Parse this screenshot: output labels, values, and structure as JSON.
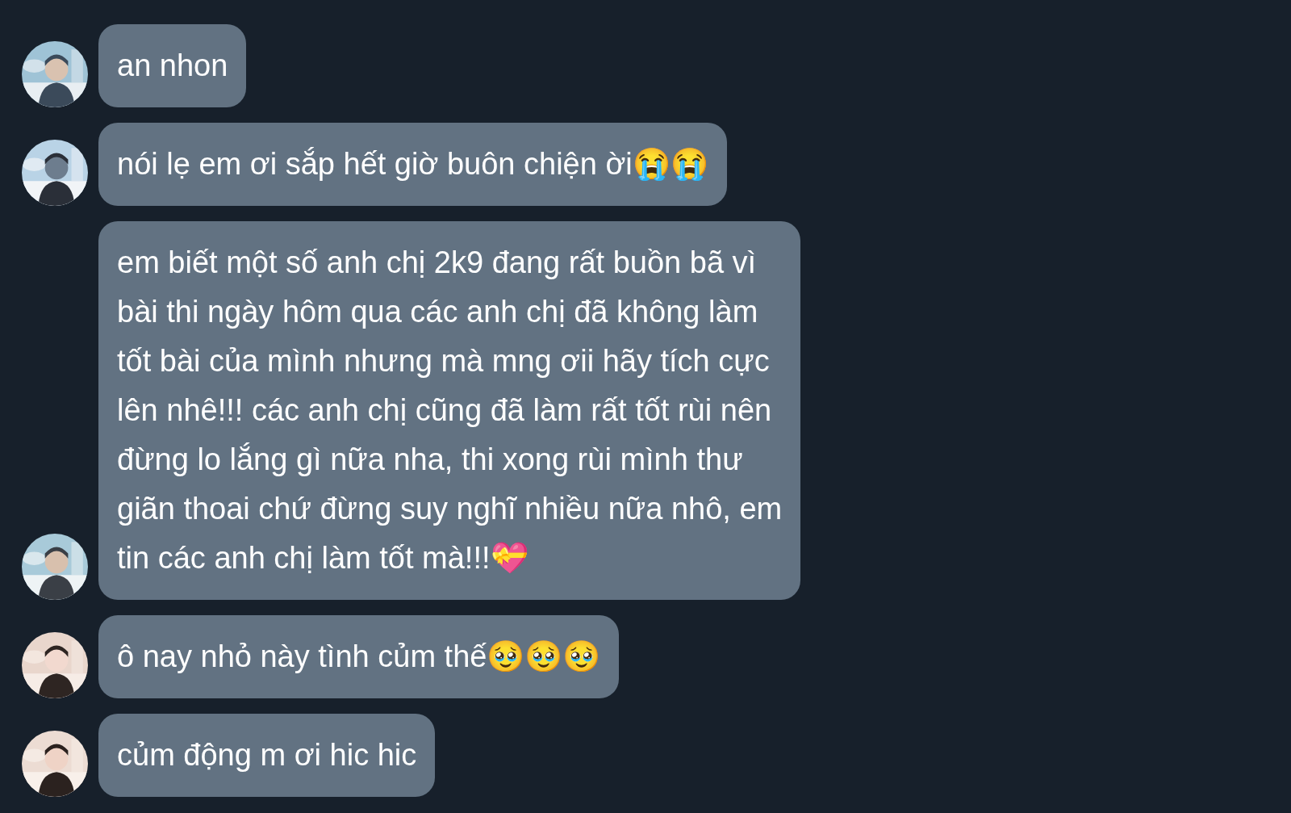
{
  "messages": [
    {
      "text": "an nhon"
    },
    {
      "text": "nói lẹ em ơi sắp hết giờ buôn chiện ời😭😭"
    },
    {
      "text": "em biết một số anh chị 2k9 đang rất buồn bã vì\nbài thi ngày hôm qua các anh chị đã không làm\ntốt bài của mình nhưng mà mng ơii hãy tích cực\nlên nhê!!! các anh chị cũng đã làm rất tốt rùi nên\nđừng lo lắng gì nữa nha, thi xong rùi mình thư\ngiãn thoai chứ đừng suy nghĩ nhiều nữa nhô, em\ntin các anh chị làm tốt mà!!!💝"
    },
    {
      "text": "ô nay nhỏ này tình củm thế🥹🥹🥹"
    },
    {
      "text": "củm động m ơi hic hic"
    }
  ]
}
